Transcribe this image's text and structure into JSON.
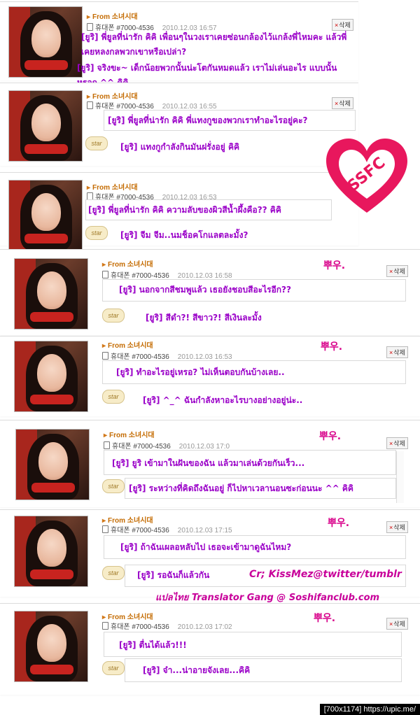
{
  "posts": [
    {
      "from": "From 소녀시대",
      "sender": "휴대폰 #7000-4536",
      "date": "2010.12.03 16:57",
      "delete": "삭제",
      "messages": [
        "[ยูริ] พี่ยูลที่น่ารัก คิคิ เพื่อนๆในวงเราเคยซ่อนกล้องไว้แกล้งพี่ไหมคะ แล้วพี่เคยหลงกลพวกเขาหรือเปล่า?",
        "[ยูริ] จริงขะ~ เด็กน้อยพวกนั้นน่ะโตกันหมดแล้ว เราไม่เล่นอะไร แบบนั้นหรอก ^^ คิคิ"
      ]
    },
    {
      "from": "From 소녀시대",
      "sender": "휴대폰 #7000-4536",
      "date": "2010.12.03 16:55",
      "delete": "삭제",
      "star": "star",
      "messages": [
        "[ยูริ] พี่ยูลที่น่ารัก คิคิ พี่แทงกูของพวกเราทำอะไรอยู่คะ?",
        "[ยูริ] แทงกูกำลังกินมันฝรั่งอยู่ คิคิ"
      ]
    },
    {
      "from": "From 소녀시대",
      "sender": "휴대폰 #7000-4536",
      "date": "2010.12.03 16:53",
      "star": "star",
      "messages": [
        "[ยูริ] พี่ยูลที่น่ารัก คิคิ ความลับของผิวสีน้ำผึ้งคือ?? คิคิ",
        "[ยูริ] จีม จีม..นมช็อคโกแลตละมั้ง?"
      ]
    },
    {
      "from": "From 소녀시대",
      "sender": "휴대폰 #7000-4536",
      "date": "2010.12.03 16:58",
      "delete": "삭제",
      "star": "star",
      "ppu": "뿌우.",
      "messages": [
        "[ยูริ] นอกจากสีชมพูแล้ว เธอยังชอบสีอะไรอีก??",
        "[ยูริ] สีดำ?! สีขาว?! สีเงินละมั้ง"
      ]
    },
    {
      "from": "From 소녀시대",
      "sender": "휴대폰 #7000-4536",
      "date": "2010.12.03 16:53",
      "delete": "삭제",
      "star": "star",
      "ppu": "뿌우.",
      "messages": [
        "[ยูริ] ทำอะไรอยู่เหรอ? ไม่เห็นตอบกันบ้างเลย..",
        "[ยูริ] ^_^ ฉันกำลังหาอะไรบางอย่างอยู่น่ะ.."
      ]
    },
    {
      "from": "From 소녀시대",
      "sender": "휴대폰 #7000-4536",
      "date": "2010.12.03 17:0",
      "delete": "삭제",
      "star": "star",
      "ppu": "뿌우.",
      "messages": [
        "[ยูริ] ยูริ เข้ามาในฝันของฉัน แล้วมาเล่นด้วยกันเร็ว...",
        "[ยูริ] ระหว่างที่คิดถึงฉันอยู่ ก็ไปหาเวลานอนซะก่อนนะ ^^ คิคิ"
      ]
    },
    {
      "from": "From 소녀시대",
      "sender": "휴대폰 #7000-4536",
      "date": "2010.12.03 17:15",
      "delete": "삭제",
      "star": "star",
      "ppu": "뿌우.",
      "messages": [
        "[ยูริ] ถ้าฉันเผลอหลับไป เธอจะเข้ามาดูฉันไหม?",
        "[ยูริ] รอฉันก็แล้วกัน"
      ]
    },
    {
      "from": "From 소녀시대",
      "sender": "휴대폰 #7000-4536",
      "date": "2010.12.03 17:02",
      "delete": "삭제",
      "star": "star",
      "ppu": "뿌우.",
      "messages": [
        "[ยูริ] ตื่นได้แล้ว!!!",
        "[ยูริ] จ๋า...น่าอายจังเลย...คิคิ"
      ]
    }
  ],
  "credits": {
    "line1": "Cr; KissMez@twitter/tumblr",
    "line2": "แปลไทย Translator Gang @ Soshifanclub.com"
  },
  "logo": {
    "text": "SSFC",
    "subtext": "SOSHIFANCLUB",
    "color": "#e8175d"
  },
  "footer": "[700x1174] https://upic.me/"
}
